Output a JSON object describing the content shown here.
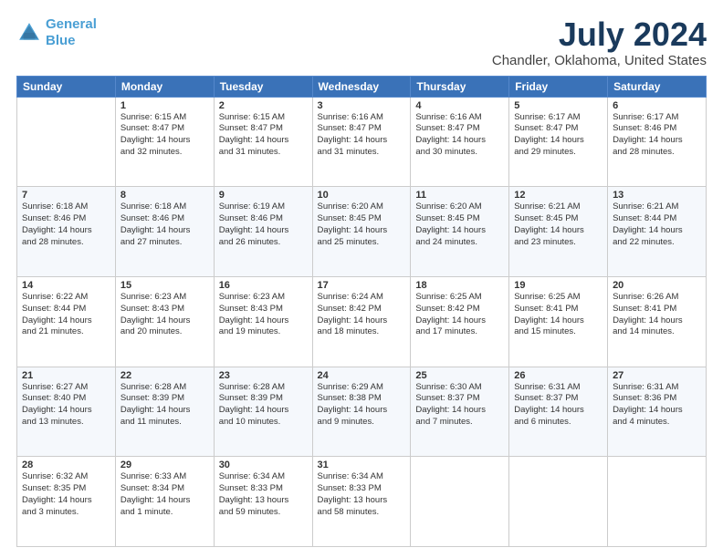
{
  "logo": {
    "line1": "General",
    "line2": "Blue"
  },
  "title": "July 2024",
  "subtitle": "Chandler, Oklahoma, United States",
  "calendar": {
    "headers": [
      "Sunday",
      "Monday",
      "Tuesday",
      "Wednesday",
      "Thursday",
      "Friday",
      "Saturday"
    ],
    "rows": [
      [
        {
          "day": "",
          "info": ""
        },
        {
          "day": "1",
          "info": "Sunrise: 6:15 AM\nSunset: 8:47 PM\nDaylight: 14 hours\nand 32 minutes."
        },
        {
          "day": "2",
          "info": "Sunrise: 6:15 AM\nSunset: 8:47 PM\nDaylight: 14 hours\nand 31 minutes."
        },
        {
          "day": "3",
          "info": "Sunrise: 6:16 AM\nSunset: 8:47 PM\nDaylight: 14 hours\nand 31 minutes."
        },
        {
          "day": "4",
          "info": "Sunrise: 6:16 AM\nSunset: 8:47 PM\nDaylight: 14 hours\nand 30 minutes."
        },
        {
          "day": "5",
          "info": "Sunrise: 6:17 AM\nSunset: 8:47 PM\nDaylight: 14 hours\nand 29 minutes."
        },
        {
          "day": "6",
          "info": "Sunrise: 6:17 AM\nSunset: 8:46 PM\nDaylight: 14 hours\nand 28 minutes."
        }
      ],
      [
        {
          "day": "7",
          "info": "Sunrise: 6:18 AM\nSunset: 8:46 PM\nDaylight: 14 hours\nand 28 minutes."
        },
        {
          "day": "8",
          "info": "Sunrise: 6:18 AM\nSunset: 8:46 PM\nDaylight: 14 hours\nand 27 minutes."
        },
        {
          "day": "9",
          "info": "Sunrise: 6:19 AM\nSunset: 8:46 PM\nDaylight: 14 hours\nand 26 minutes."
        },
        {
          "day": "10",
          "info": "Sunrise: 6:20 AM\nSunset: 8:45 PM\nDaylight: 14 hours\nand 25 minutes."
        },
        {
          "day": "11",
          "info": "Sunrise: 6:20 AM\nSunset: 8:45 PM\nDaylight: 14 hours\nand 24 minutes."
        },
        {
          "day": "12",
          "info": "Sunrise: 6:21 AM\nSunset: 8:45 PM\nDaylight: 14 hours\nand 23 minutes."
        },
        {
          "day": "13",
          "info": "Sunrise: 6:21 AM\nSunset: 8:44 PM\nDaylight: 14 hours\nand 22 minutes."
        }
      ],
      [
        {
          "day": "14",
          "info": "Sunrise: 6:22 AM\nSunset: 8:44 PM\nDaylight: 14 hours\nand 21 minutes."
        },
        {
          "day": "15",
          "info": "Sunrise: 6:23 AM\nSunset: 8:43 PM\nDaylight: 14 hours\nand 20 minutes."
        },
        {
          "day": "16",
          "info": "Sunrise: 6:23 AM\nSunset: 8:43 PM\nDaylight: 14 hours\nand 19 minutes."
        },
        {
          "day": "17",
          "info": "Sunrise: 6:24 AM\nSunset: 8:42 PM\nDaylight: 14 hours\nand 18 minutes."
        },
        {
          "day": "18",
          "info": "Sunrise: 6:25 AM\nSunset: 8:42 PM\nDaylight: 14 hours\nand 17 minutes."
        },
        {
          "day": "19",
          "info": "Sunrise: 6:25 AM\nSunset: 8:41 PM\nDaylight: 14 hours\nand 15 minutes."
        },
        {
          "day": "20",
          "info": "Sunrise: 6:26 AM\nSunset: 8:41 PM\nDaylight: 14 hours\nand 14 minutes."
        }
      ],
      [
        {
          "day": "21",
          "info": "Sunrise: 6:27 AM\nSunset: 8:40 PM\nDaylight: 14 hours\nand 13 minutes."
        },
        {
          "day": "22",
          "info": "Sunrise: 6:28 AM\nSunset: 8:39 PM\nDaylight: 14 hours\nand 11 minutes."
        },
        {
          "day": "23",
          "info": "Sunrise: 6:28 AM\nSunset: 8:39 PM\nDaylight: 14 hours\nand 10 minutes."
        },
        {
          "day": "24",
          "info": "Sunrise: 6:29 AM\nSunset: 8:38 PM\nDaylight: 14 hours\nand 9 minutes."
        },
        {
          "day": "25",
          "info": "Sunrise: 6:30 AM\nSunset: 8:37 PM\nDaylight: 14 hours\nand 7 minutes."
        },
        {
          "day": "26",
          "info": "Sunrise: 6:31 AM\nSunset: 8:37 PM\nDaylight: 14 hours\nand 6 minutes."
        },
        {
          "day": "27",
          "info": "Sunrise: 6:31 AM\nSunset: 8:36 PM\nDaylight: 14 hours\nand 4 minutes."
        }
      ],
      [
        {
          "day": "28",
          "info": "Sunrise: 6:32 AM\nSunset: 8:35 PM\nDaylight: 14 hours\nand 3 minutes."
        },
        {
          "day": "29",
          "info": "Sunrise: 6:33 AM\nSunset: 8:34 PM\nDaylight: 14 hours\nand 1 minute."
        },
        {
          "day": "30",
          "info": "Sunrise: 6:34 AM\nSunset: 8:33 PM\nDaylight: 13 hours\nand 59 minutes."
        },
        {
          "day": "31",
          "info": "Sunrise: 6:34 AM\nSunset: 8:33 PM\nDaylight: 13 hours\nand 58 minutes."
        },
        {
          "day": "",
          "info": ""
        },
        {
          "day": "",
          "info": ""
        },
        {
          "day": "",
          "info": ""
        }
      ]
    ]
  }
}
